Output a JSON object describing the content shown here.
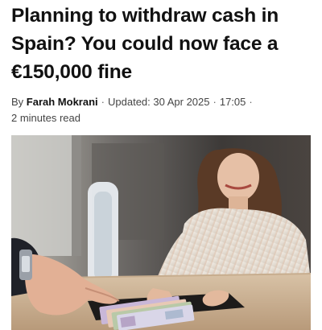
{
  "article": {
    "headline_lines": [
      "Planning to withdraw cash in",
      "Spain? You could now face a",
      "€150,000 fine"
    ],
    "byline": {
      "by_prefix": "By",
      "author": "Farah Mokrani",
      "separator": "·",
      "updated": "Updated: 30 Apr 2025",
      "time": "17:05",
      "read_time": "2 minutes read"
    },
    "image": {
      "subject": "bank-teller-handing-euro-banknotes-photo"
    }
  }
}
